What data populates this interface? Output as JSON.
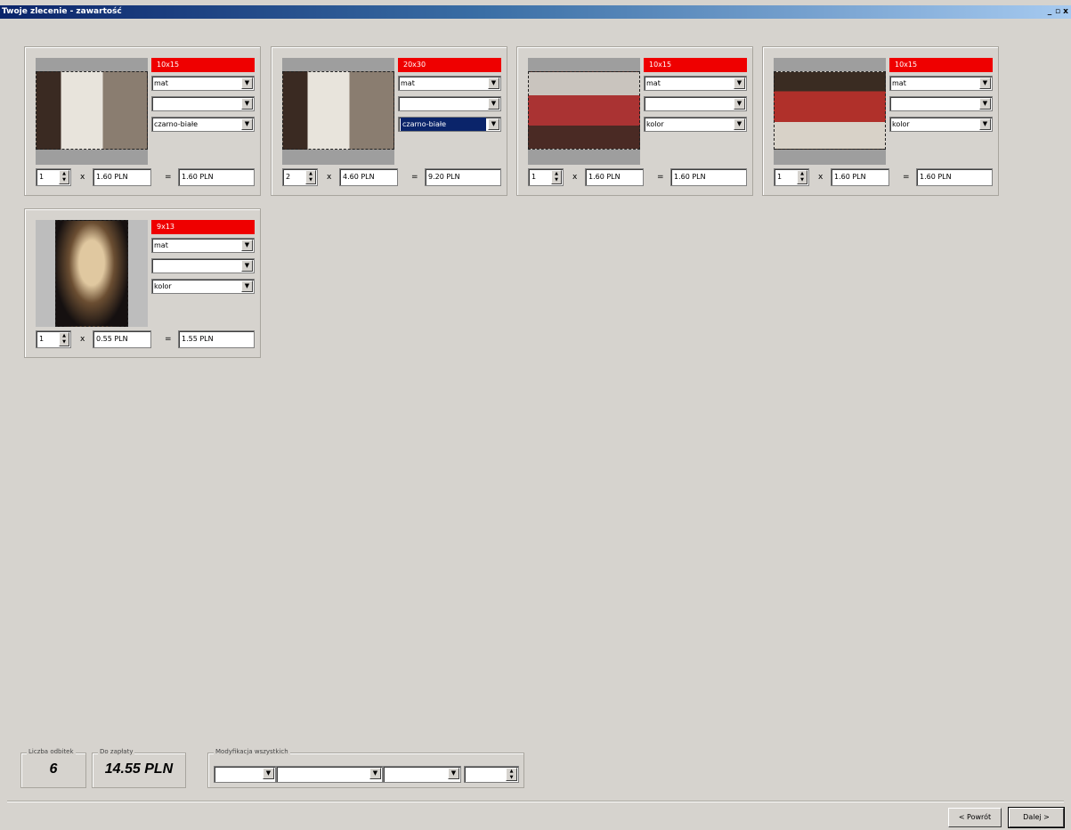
{
  "window": {
    "title": "Twoje zlecenie - zawartość",
    "controls": [
      "_",
      "▫",
      "x"
    ]
  },
  "items": [
    {
      "size": "10x15",
      "paper": "mat",
      "border": "",
      "color_mode": "czarno-białe",
      "color_mode_highlighted": false,
      "quantity": "1",
      "unit_price": "1.60 PLN",
      "total": "1.60 PLN",
      "orientation": "landscape",
      "photo_theme": "living-room"
    },
    {
      "size": "20x30",
      "paper": "mat",
      "border": "",
      "color_mode": "czarno-białe",
      "color_mode_highlighted": true,
      "quantity": "2",
      "unit_price": "4.60 PLN",
      "total": "9.20 PLN",
      "orientation": "landscape",
      "photo_theme": "living-room"
    },
    {
      "size": "10x15",
      "paper": "mat",
      "border": "",
      "color_mode": "kolor",
      "color_mode_highlighted": false,
      "quantity": "1",
      "unit_price": "1.60 PLN",
      "total": "1.60 PLN",
      "orientation": "landscape",
      "photo_theme": "bedroom"
    },
    {
      "size": "10x15",
      "paper": "mat",
      "border": "",
      "color_mode": "kolor",
      "color_mode_highlighted": false,
      "quantity": "1",
      "unit_price": "1.60 PLN",
      "total": "1.60 PLN",
      "orientation": "landscape",
      "photo_theme": "red-room"
    },
    {
      "size": "9x13",
      "paper": "mat",
      "border": "",
      "color_mode": "kolor",
      "color_mode_highlighted": false,
      "quantity": "1",
      "unit_price": "0.55 PLN",
      "total": "1.55 PLN",
      "orientation": "portrait",
      "photo_theme": "dark-lounge"
    }
  ],
  "operators": {
    "times": "x",
    "equals": "="
  },
  "summary": {
    "count_label": "Liczba odbitek",
    "count_value": "6",
    "amount_label": "Do zapłaty",
    "amount_value": "14.55 PLN",
    "modify_all_label": "Modyfikacja wszystkich"
  },
  "buttons": {
    "back": "< Powrót",
    "next": "Dalej >"
  },
  "colors": {
    "background": "#d6d3ce",
    "size_label": "#ef0000",
    "selection": "#0a246a"
  }
}
